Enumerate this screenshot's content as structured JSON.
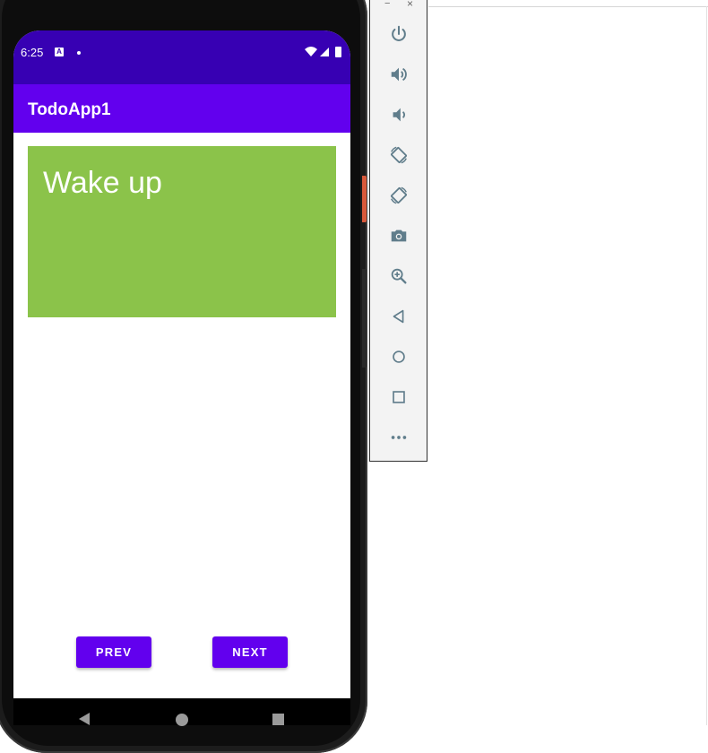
{
  "status_bar": {
    "time": "6:25",
    "badge": "A",
    "icons": [
      "wifi-icon",
      "signal-icon",
      "battery-icon"
    ]
  },
  "app_bar": {
    "title": "TodoApp1"
  },
  "todo": {
    "text": "Wake up",
    "card_color": "#8bc34a"
  },
  "buttons": {
    "prev_label": "PREV",
    "next_label": "NEXT"
  },
  "nav_bar": {
    "icons": [
      "back-icon",
      "home-icon",
      "recents-icon"
    ]
  },
  "emulator_toolbar": {
    "window_controls": {
      "minimize": "−",
      "close": "×"
    },
    "tools": [
      {
        "name": "power-icon"
      },
      {
        "name": "volume-up-icon"
      },
      {
        "name": "volume-down-icon"
      },
      {
        "name": "rotate-left-icon"
      },
      {
        "name": "rotate-right-icon"
      },
      {
        "name": "camera-icon"
      },
      {
        "name": "zoom-icon"
      },
      {
        "name": "back-icon"
      },
      {
        "name": "home-icon"
      },
      {
        "name": "overview-icon"
      },
      {
        "name": "more-icon"
      }
    ]
  },
  "colors": {
    "status_bar": "#3700b3",
    "primary": "#6200ee",
    "card": "#8bc34a",
    "toolbar_icon": "#607d8b"
  }
}
